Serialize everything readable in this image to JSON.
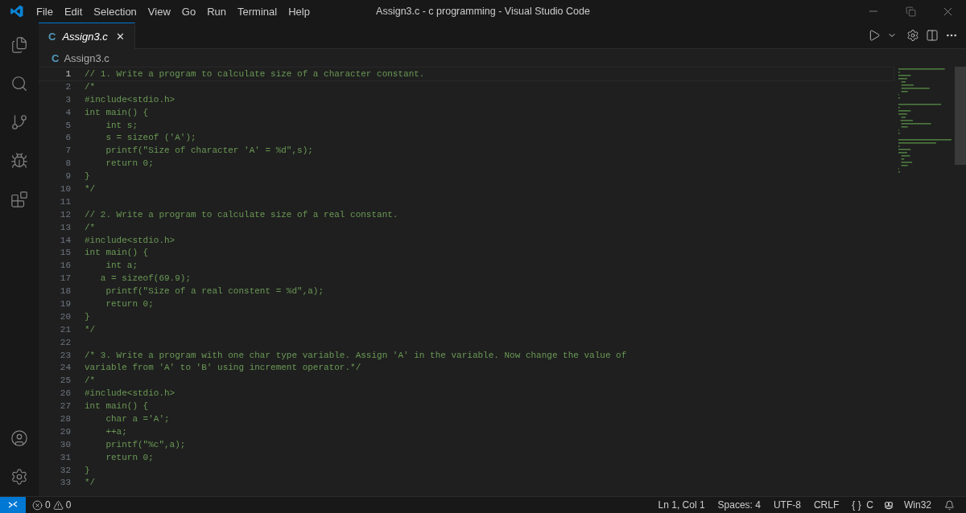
{
  "window": {
    "title": "Assign3.c - c programming - Visual Studio Code"
  },
  "menu": [
    "File",
    "Edit",
    "Selection",
    "View",
    "Go",
    "Run",
    "Terminal",
    "Help"
  ],
  "tabs": [
    {
      "icon_text": "C",
      "label": "Assign3.c",
      "close": "✕",
      "selected": true
    }
  ],
  "breadcrumb": {
    "icon_text": "C",
    "label": "Assign3.c"
  },
  "lines": [
    {
      "number": "1",
      "text": "// 1. Write a program to calculate size of a character constant.",
      "current": true
    },
    {
      "number": "2",
      "text": "/*",
      "current": false
    },
    {
      "number": "3",
      "text": "#include<stdio.h>",
      "current": false
    },
    {
      "number": "4",
      "text": "int main() {",
      "current": false
    },
    {
      "number": "5",
      "text": "    int s;",
      "current": false
    },
    {
      "number": "6",
      "text": "    s = sizeof ('A');",
      "current": false
    },
    {
      "number": "7",
      "text": "    printf(\"Size of character 'A' = %d\",s);",
      "current": false
    },
    {
      "number": "8",
      "text": "    return 0;",
      "current": false
    },
    {
      "number": "9",
      "text": "}",
      "current": false
    },
    {
      "number": "10",
      "text": "*/",
      "current": false
    },
    {
      "number": "11",
      "current": false
    },
    {
      "number": "12",
      "text": "// 2. Write a program to calculate size of a real constant.",
      "current": false
    },
    {
      "number": "13",
      "text": "/*",
      "current": false
    },
    {
      "number": "14",
      "text": "#include<stdio.h>",
      "current": false
    },
    {
      "number": "15",
      "text": "int main() {",
      "current": false
    },
    {
      "number": "16",
      "text": "    int a;",
      "current": false
    },
    {
      "number": "17",
      "text": "   a = sizeof(69.9);",
      "current": false
    },
    {
      "number": "18",
      "text": "    printf(\"Size of a real constent = %d\",a);",
      "current": false
    },
    {
      "number": "19",
      "text": "    return 0;",
      "current": false
    },
    {
      "number": "20",
      "text": "}",
      "current": false
    },
    {
      "number": "21",
      "text": "*/",
      "current": false
    },
    {
      "number": "22",
      "current": false
    },
    {
      "number": "23",
      "text": "/* 3. Write a program with one char type variable. Assign 'A' in the variable. Now change the value of",
      "current": false
    },
    {
      "number": "24",
      "text": "variable from 'A' to 'B' using increment operator.*/",
      "current": false
    },
    {
      "number": "25",
      "text": "/*",
      "current": false
    },
    {
      "number": "26",
      "text": "#include<stdio.h>",
      "current": false
    },
    {
      "number": "27",
      "text": "int main() {",
      "current": false
    },
    {
      "number": "28",
      "text": "    char a ='A';",
      "current": false
    },
    {
      "number": "29",
      "text": "    ++a;",
      "current": false
    },
    {
      "number": "30",
      "text": "    printf(\"%c\",a);",
      "current": false
    },
    {
      "number": "31",
      "text": "    return 0;",
      "current": false
    },
    {
      "number": "32",
      "text": "}",
      "current": false
    },
    {
      "number": "33",
      "text": "*/",
      "current": false
    }
  ],
  "status_bar": {
    "errors": "0",
    "warnings": "0",
    "items": [
      "Ln 1, Col 1",
      "Spaces: 4",
      "UTF-8",
      "CRLF",
      "{ }  C",
      "Win32"
    ]
  }
}
